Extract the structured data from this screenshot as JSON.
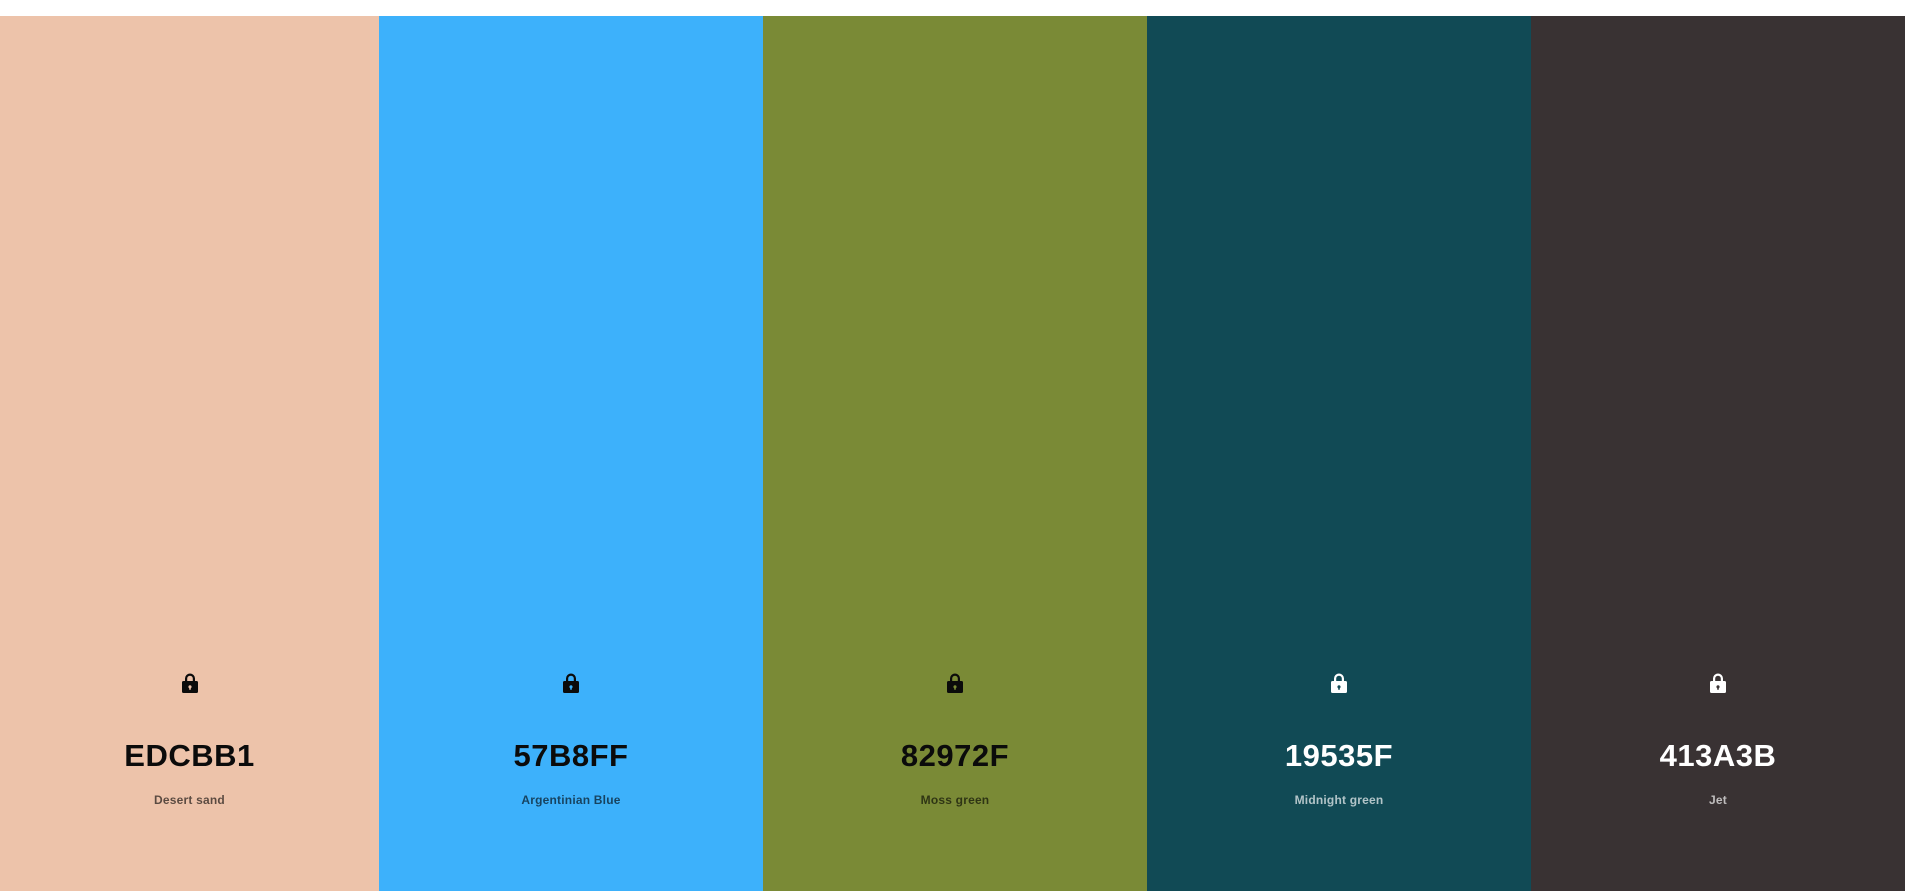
{
  "palette": {
    "colors": [
      {
        "hex": "EDCBB1",
        "name": "Desert sand",
        "color": "#EDC3AA",
        "icon": "lock-icon"
      },
      {
        "hex": "57B8FF",
        "name": "Argentinian Blue",
        "color": "#3DB1FB",
        "icon": "lock-icon"
      },
      {
        "hex": "82972F",
        "name": "Moss green",
        "color": "#7A8A36",
        "icon": "lock-icon"
      },
      {
        "hex": "19535F",
        "name": "Midnight green",
        "color": "#114A55",
        "icon": "lock-icon"
      },
      {
        "hex": "413A3B",
        "name": "Jet",
        "color": "#393233",
        "icon": "lock-icon"
      }
    ]
  }
}
